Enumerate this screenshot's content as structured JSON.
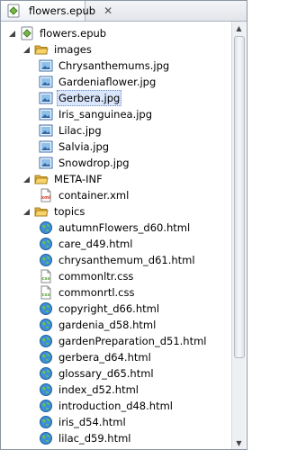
{
  "tab": {
    "title": "flowers.epub",
    "close_glyph": "✕",
    "icon": "epub-icon"
  },
  "tree": {
    "root": {
      "label": "flowers.epub",
      "icon": "epub-icon",
      "expanded": true
    },
    "images": {
      "label": "images",
      "icon": "folder-open-icon",
      "expanded": true,
      "items": [
        {
          "label": "Chrysanthemums.jpg",
          "icon": "image-file-icon"
        },
        {
          "label": "Gardeniaflower.jpg",
          "icon": "image-file-icon"
        },
        {
          "label": "Gerbera.jpg",
          "icon": "image-file-icon",
          "selected": true
        },
        {
          "label": "Iris_sanguinea.jpg",
          "icon": "image-file-icon"
        },
        {
          "label": "Lilac.jpg",
          "icon": "image-file-icon"
        },
        {
          "label": "Salvia.jpg",
          "icon": "image-file-icon"
        },
        {
          "label": "Snowdrop.jpg",
          "icon": "image-file-icon"
        }
      ]
    },
    "meta": {
      "label": "META-INF",
      "icon": "folder-open-icon",
      "expanded": true,
      "items": [
        {
          "label": "container.xml",
          "icon": "xml-file-icon"
        }
      ]
    },
    "topics": {
      "label": "topics",
      "icon": "folder-open-icon",
      "expanded": true,
      "items": [
        {
          "label": "autumnFlowers_d60.html",
          "icon": "html-globe-icon"
        },
        {
          "label": "care_d49.html",
          "icon": "html-globe-icon"
        },
        {
          "label": "chrysanthemum_d61.html",
          "icon": "html-globe-icon"
        },
        {
          "label": "commonltr.css",
          "icon": "css-file-icon"
        },
        {
          "label": "commonrtl.css",
          "icon": "css-file-icon"
        },
        {
          "label": "copyright_d66.html",
          "icon": "html-globe-icon"
        },
        {
          "label": "gardenia_d58.html",
          "icon": "html-globe-icon"
        },
        {
          "label": "gardenPreparation_d51.html",
          "icon": "html-globe-icon"
        },
        {
          "label": "gerbera_d64.html",
          "icon": "html-globe-icon"
        },
        {
          "label": "glossary_d65.html",
          "icon": "html-globe-icon"
        },
        {
          "label": "index_d52.html",
          "icon": "html-globe-icon"
        },
        {
          "label": "introduction_d48.html",
          "icon": "html-globe-icon"
        },
        {
          "label": "iris_d54.html",
          "icon": "html-globe-icon"
        },
        {
          "label": "lilac_d59.html",
          "icon": "html-globe-icon"
        }
      ]
    }
  },
  "colors": {
    "selection": "#d9e6fb",
    "folder": "#f3c552",
    "globe": "#3c8fd8",
    "css": "#5aa53a",
    "xml": "#d9392b"
  }
}
